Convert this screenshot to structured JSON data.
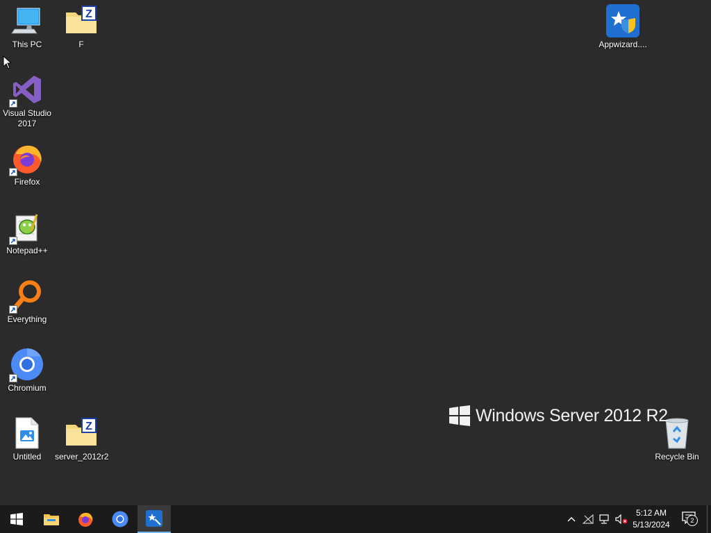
{
  "desktop": {
    "icons": [
      {
        "label": "This PC",
        "icon": "this-pc-icon"
      },
      {
        "label": "F",
        "icon": "zip-folder-icon"
      },
      {
        "label": "Appwizard....",
        "icon": "appwizard-icon"
      },
      {
        "label": "Visual Studio 2017",
        "icon": "visual-studio-icon"
      },
      {
        "label": "Firefox",
        "icon": "firefox-icon"
      },
      {
        "label": "Notepad++",
        "icon": "notepad-plus-plus-icon"
      },
      {
        "label": "Everything",
        "icon": "everything-search-icon"
      },
      {
        "label": "Chromium",
        "icon": "chromium-icon"
      },
      {
        "label": "Untitled",
        "icon": "image-file-icon"
      },
      {
        "label": "server_2012r2",
        "icon": "zip-folder-icon"
      },
      {
        "label": "Recycle Bin",
        "icon": "recycle-bin-icon"
      }
    ],
    "watermark": "Windows Server 2012 R2"
  },
  "taskbar": {
    "pinned": [
      {
        "name": "start-button",
        "icon": "windows-logo-icon"
      },
      {
        "name": "file-explorer",
        "icon": "folder-icon"
      },
      {
        "name": "firefox",
        "icon": "firefox-icon"
      },
      {
        "name": "chromium",
        "icon": "chromium-icon"
      },
      {
        "name": "appwizard",
        "icon": "appwizard-icon",
        "active": true
      }
    ],
    "tray": {
      "icons": [
        "chevron-up-icon",
        "network-disconnected-icon",
        "network-icon",
        "volume-muted-icon"
      ],
      "time": "5:12 AM",
      "date": "5/13/2024",
      "notifications_count": "2"
    }
  },
  "colors": {
    "desktop_bg": "#2b2b2b",
    "taskbar_bg": "#1b1b1b",
    "accent": "#76b9ed"
  }
}
